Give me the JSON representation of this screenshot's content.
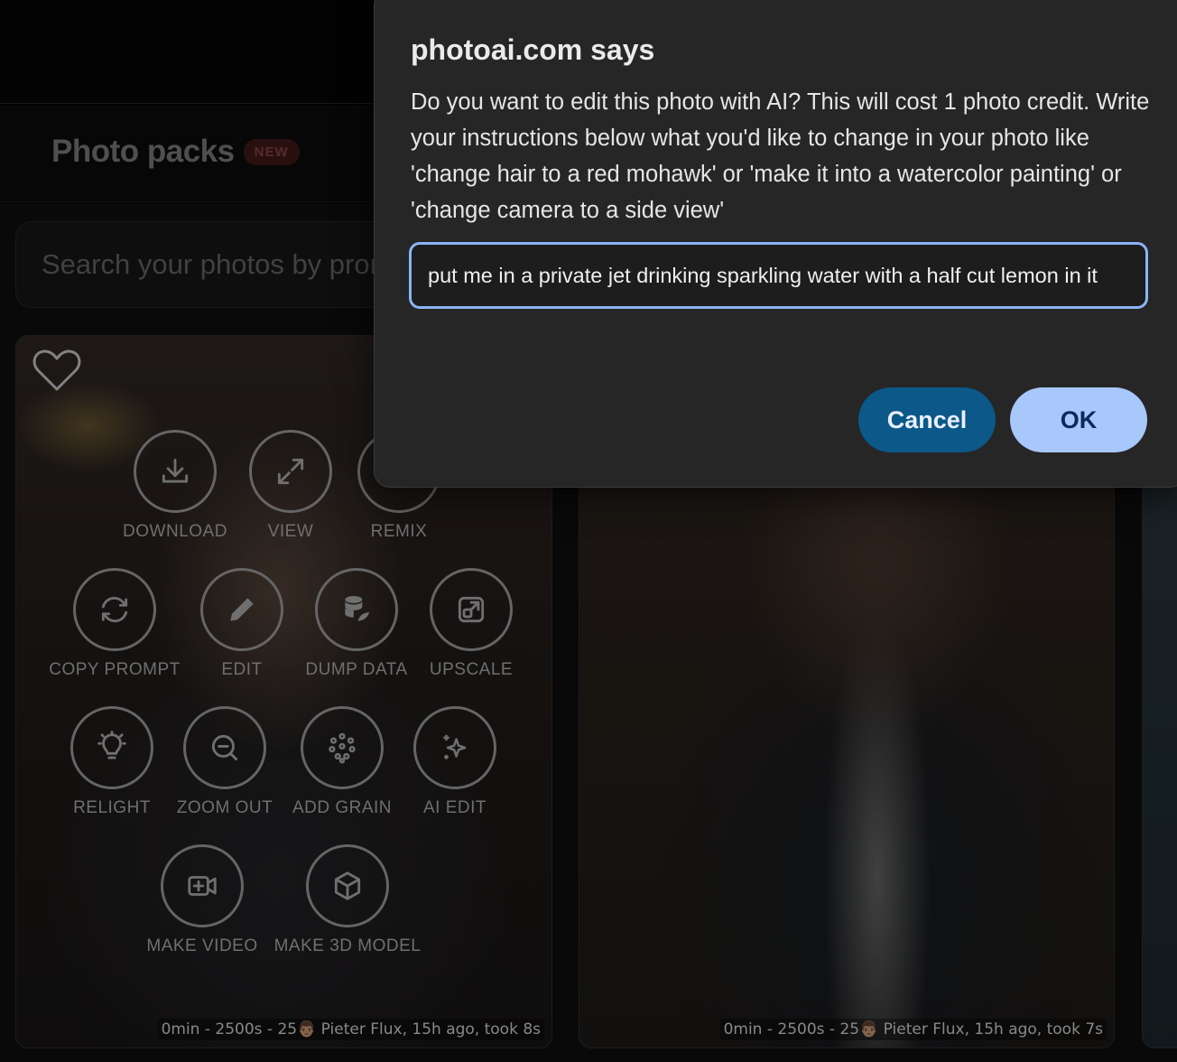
{
  "header": {
    "tab_label": "Photo packs",
    "tab_badge": "NEW"
  },
  "search": {
    "placeholder": "Search your photos by prompt"
  },
  "card1": {
    "actions": [
      {
        "label": "DOWNLOAD",
        "icon": "download-icon"
      },
      {
        "label": "VIEW",
        "icon": "expand-icon"
      },
      {
        "label": "REMIX",
        "icon": "remix-icon"
      },
      {
        "label": "COPY PROMPT",
        "icon": "refresh-icon"
      },
      {
        "label": "EDIT",
        "icon": "pencil-icon"
      },
      {
        "label": "DUMP DATA",
        "icon": "database-icon"
      },
      {
        "label": "UPSCALE",
        "icon": "upscale-icon"
      },
      {
        "label": "RELIGHT",
        "icon": "lightbulb-icon"
      },
      {
        "label": "ZOOM OUT",
        "icon": "zoom-out-icon"
      },
      {
        "label": "ADD GRAIN",
        "icon": "grain-icon"
      },
      {
        "label": "AI EDIT",
        "icon": "sparkles-icon"
      },
      {
        "label": "MAKE VIDEO",
        "icon": "video-icon"
      },
      {
        "label": "MAKE 3D MODEL",
        "icon": "cube-icon"
      }
    ],
    "caption": "0min - 2500s - 25👨🏽 Pieter Flux, 15h ago, took 8s"
  },
  "card2": {
    "caption": "0min - 2500s - 25👨🏽 Pieter Flux, 15h ago, took 7s"
  },
  "dialog": {
    "title": "photoai.com says",
    "message": "Do you want to edit this photo with AI? This will cost 1 photo credit. Write your instructions below what you'd like to change in your photo like 'change hair to a red mohawk' or 'make it into a watercolor painting' or 'change camera to a side view'",
    "input_value": "put me in a private jet drinking sparkling water with a half cut lemon in it",
    "cancel_label": "Cancel",
    "ok_label": "OK"
  },
  "colors": {
    "dialog_bg": "#262626",
    "input_focus": "#8ab4f8",
    "cancel_bg": "#0b5889",
    "ok_bg": "#a8c7fa"
  }
}
